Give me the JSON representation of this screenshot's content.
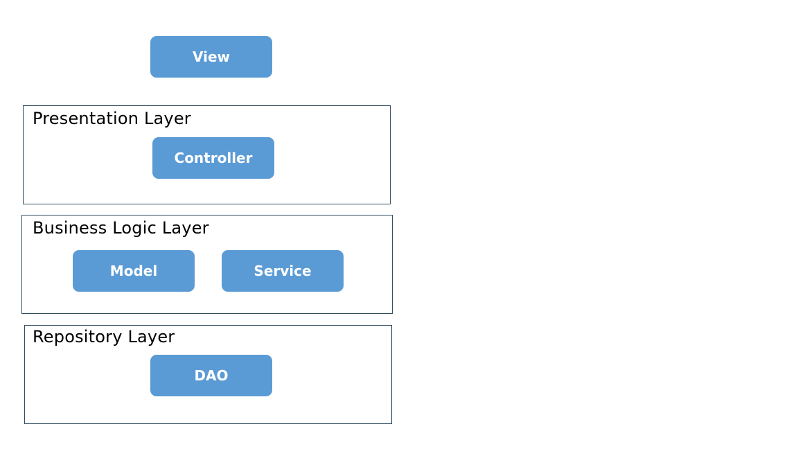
{
  "diagram": {
    "view": {
      "label": "View"
    },
    "presentation_layer": {
      "title": "Presentation Layer",
      "components": [
        {
          "label": "Controller"
        }
      ]
    },
    "business_logic_layer": {
      "title": "Business Logic Layer",
      "components": [
        {
          "label": "Model"
        },
        {
          "label": "Service"
        }
      ]
    },
    "repository_layer": {
      "title": "Repository Layer",
      "components": [
        {
          "label": "DAO"
        }
      ]
    },
    "colors": {
      "component_fill": "#5b9bd5",
      "component_text": "#ffffff",
      "layer_border": "#2f4b5f"
    }
  }
}
